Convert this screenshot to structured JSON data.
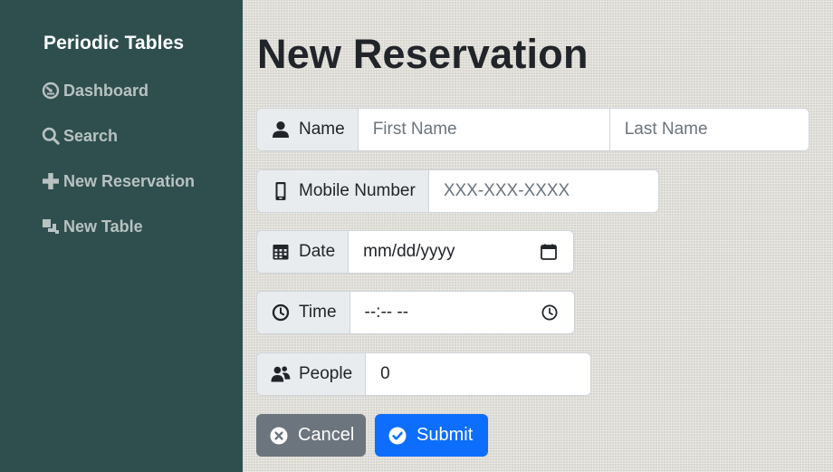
{
  "sidebar": {
    "brand": "Periodic Tables",
    "items": [
      {
        "label": "Dashboard",
        "icon": "dashboard-icon"
      },
      {
        "label": "Search",
        "icon": "search-icon"
      },
      {
        "label": "New Reservation",
        "icon": "plus-icon"
      },
      {
        "label": "New Table",
        "icon": "layers-icon"
      }
    ]
  },
  "main": {
    "title": "New Reservation",
    "form": {
      "name": {
        "label": "Name",
        "icon": "person-icon",
        "first_placeholder": "First Name",
        "last_placeholder": "Last Name"
      },
      "mobile": {
        "label": "Mobile Number",
        "icon": "phone-icon",
        "placeholder": "XXX-XXX-XXXX"
      },
      "date": {
        "label": "Date",
        "icon": "calendar-icon",
        "value": "mm/dd/yyyy"
      },
      "time": {
        "label": "Time",
        "icon": "clock-icon",
        "value": "--:-- --"
      },
      "people": {
        "label": "People",
        "icon": "people-icon",
        "value": "0"
      }
    },
    "buttons": {
      "cancel": {
        "label": "Cancel",
        "icon": "x-circle-icon"
      },
      "submit": {
        "label": "Submit",
        "icon": "check-circle-icon"
      }
    }
  },
  "colors": {
    "sidebar_bg": "#2f4f4f",
    "nav_text": "#b8c2c0",
    "cancel": "#6c757d",
    "submit": "#0d6efd",
    "addon_bg": "#e9ecef"
  }
}
